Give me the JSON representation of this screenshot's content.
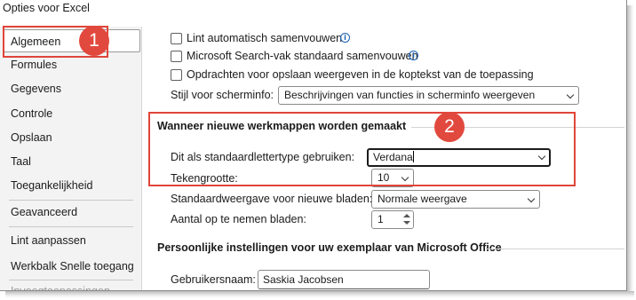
{
  "window": {
    "title": "Opties voor Excel"
  },
  "nav": {
    "items": [
      {
        "label": "Algemeen",
        "selected": true
      },
      {
        "label": "Formules"
      },
      {
        "label": "Gegevens"
      },
      {
        "label": "Controle"
      },
      {
        "label": "Opslaan"
      },
      {
        "label": "Taal"
      },
      {
        "label": "Toegankelijkheid"
      },
      {
        "label": "Geavanceerd"
      },
      {
        "label": "Lint aanpassen"
      },
      {
        "label": "Werkbalk Snelle toegang"
      },
      {
        "label": "Invoegtoepassingen"
      }
    ]
  },
  "ui_options": {
    "checkboxes": [
      {
        "label": "Lint automatisch samenvouwen",
        "checked": false,
        "info": true
      },
      {
        "label": "Microsoft Search-vak standaard samenvouwen",
        "checked": false,
        "info": true
      },
      {
        "label": "Opdrachten voor opslaan weergeven in de koptekst van de toepassing",
        "checked": false,
        "info": false
      }
    ],
    "screentip_label": "Stijl voor scherminfo:",
    "screentip_value": "Beschrijvingen van functies in scherminfo weergeven"
  },
  "new_workbooks": {
    "heading": "Wanneer nieuwe werkmappen worden gemaakt",
    "font_label": "Dit als standaardlettertype gebruiken:",
    "font_value": "Verdana",
    "size_label": "Tekengrootte:",
    "size_value": "10",
    "view_label": "Standaardweergave voor nieuwe bladen:",
    "view_value": "Normale weergave",
    "sheets_label": "Aantal op te nemen bladen:",
    "sheets_value": "1"
  },
  "personalize": {
    "heading": "Persoonlijke instellingen voor uw exemplaar van Microsoft Office",
    "username_label": "Gebruikersnaam:",
    "username_value": "Saskia Jacobsen"
  },
  "callouts": {
    "badge1": "1",
    "badge2": "2",
    "color": "#e0453a"
  },
  "icons": {
    "info": "info-circle-icon",
    "dropdown": "chevron-down-icon",
    "spinner": "spin-arrows-icon"
  }
}
